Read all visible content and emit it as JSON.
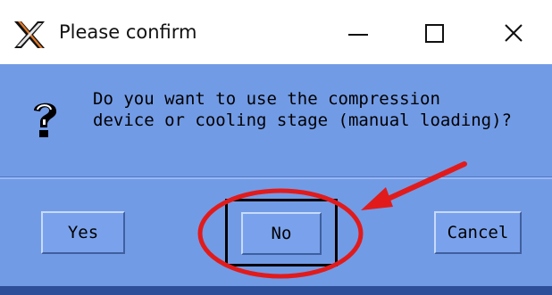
{
  "window": {
    "title": "Please confirm",
    "controls": {
      "minimize": "minimize-icon",
      "maximize": "maximize-icon",
      "close": "close-icon"
    }
  },
  "dialog": {
    "icon": "question-icon",
    "message_line1": "Do you want to use the compression",
    "message_line2": "device or cooling stage (manual loading)?"
  },
  "buttons": {
    "yes": "Yes",
    "no": "No",
    "cancel": "Cancel",
    "default": "No"
  },
  "annotation": {
    "highlight": "No",
    "color": "#e11b1b"
  },
  "colors": {
    "dialog_bg": "#729be6",
    "button_bg": "#7aa2ec",
    "titlebar_bg": "#ffffff"
  }
}
